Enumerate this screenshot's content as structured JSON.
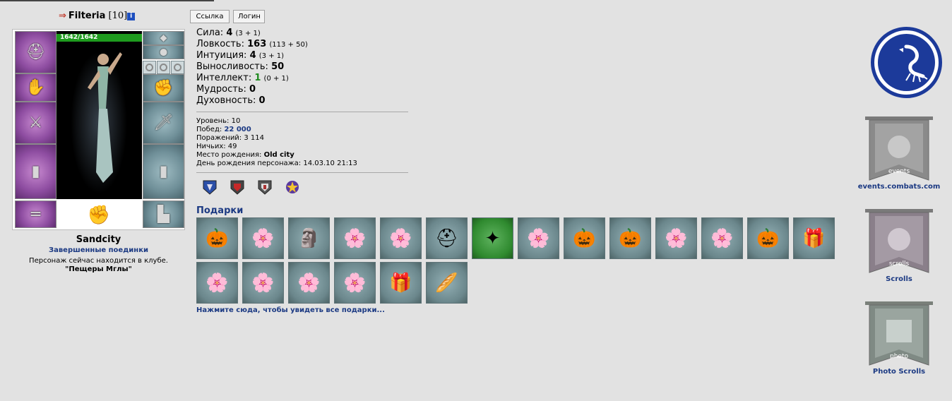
{
  "character": {
    "arrow": "⇒",
    "name": "Filteria",
    "level": "[10]",
    "info_icon": "i",
    "hp": "1642/1642",
    "city": "Sandcity",
    "finished_fights": "Завершенные поединки",
    "status_line": "Персонаж сейчас находится в клубе.",
    "location": "\"Пещеры Мглы\""
  },
  "buttons": {
    "link": "Ссылка",
    "login": "Логин"
  },
  "stats": [
    {
      "label": "Сила:",
      "value": "4",
      "detail": "(3 + 1)"
    },
    {
      "label": "Ловкость:",
      "value": "163",
      "detail": "(113 + 50)"
    },
    {
      "label": "Интуиция:",
      "value": "4",
      "detail": "(3 + 1)"
    },
    {
      "label": "Выносливость:",
      "value": "50",
      "detail": ""
    },
    {
      "label": "Интеллект:",
      "value": "1",
      "detail": "(0 + 1)"
    },
    {
      "label": "Мудрость:",
      "value": "0",
      "detail": ""
    },
    {
      "label": "Духовность:",
      "value": "0",
      "detail": ""
    }
  ],
  "info": {
    "level_label": "Уровень:",
    "level_value": "10",
    "wins_label": "Побед:",
    "wins_value": "22 000",
    "losses_label": "Поражений:",
    "losses_value": "3 114",
    "draws_label": "Ничьих:",
    "draws_value": "49",
    "birthplace_label": "Место рождения:",
    "birthplace_value": "Old city",
    "birthday_label": "День рождения персонажа:",
    "birthday_value": "14.03.10 21:13"
  },
  "gifts": {
    "title": "Подарки",
    "row1": [
      "pumpkin-gift",
      "flower-gift",
      "statue-gift",
      "flower-gift",
      "flower-gift",
      "helmet-gift",
      "banner-gift",
      "flower-gift",
      "pumpkin-gift",
      "pumpkin-gift",
      "flower-gift",
      "flower-gift",
      "pumpkin-gift",
      "toys-gift"
    ],
    "row2": [
      "flower-gift",
      "flower-gift",
      "flower-gift",
      "flower-gift",
      "toys-gift",
      "bread-gift"
    ],
    "see_all": "Нажмите сюда, чтобы увидеть все подарки..."
  },
  "sidebar": {
    "events_label": "events.combats.com",
    "events_banner_text": "events",
    "scrolls_label": "Scrolls",
    "scrolls_banner_text": "scrolls",
    "photo_label": "Photo Scrolls",
    "photo_banner_text": "photo"
  },
  "colors": {
    "accent_blue": "#1c3a83",
    "hp_green": "#1e9b1e",
    "background": "#e2e2e2"
  }
}
